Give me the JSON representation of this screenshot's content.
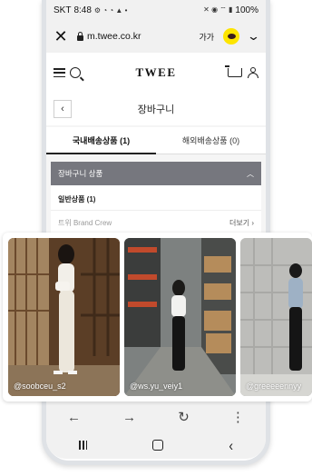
{
  "status_bar": {
    "carrier": "SKT",
    "time": "8:48",
    "battery": "100%"
  },
  "browser": {
    "url": "m.twee.co.kr",
    "translate_label": "가가"
  },
  "site": {
    "logo": "TWEE"
  },
  "page": {
    "title": "장바구니"
  },
  "tabs": [
    {
      "label": "국내배송상품 (1)"
    },
    {
      "label": "해외배송상품 (0)"
    }
  ],
  "cart_section": {
    "header": "장바구니 상품",
    "group_label": "일반상품 (1)",
    "brand": "트위 Brand Crew",
    "more_label": "더보기"
  },
  "photos": [
    {
      "handle": "@soobceu_s2"
    },
    {
      "handle": "@ws.yu_veiy1"
    },
    {
      "handle": "@greeeeennyy"
    }
  ],
  "colors": {
    "section_bar": "#76777e",
    "kakao": "#fde500"
  }
}
